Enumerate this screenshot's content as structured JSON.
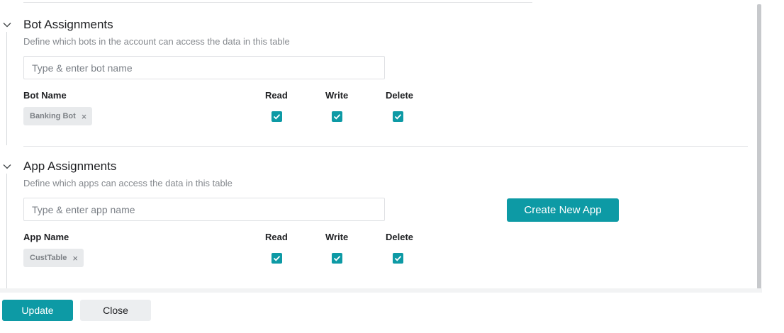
{
  "bot_assignments": {
    "title": "Bot Assignments",
    "description": "Define which bots in the account can access the data in this table",
    "input_placeholder": "Type & enter bot name",
    "columns": {
      "name": "Bot Name",
      "read": "Read",
      "write": "Write",
      "delete": "Delete"
    },
    "rows": [
      {
        "name": "Banking Bot",
        "remove": "×",
        "read": true,
        "write": true,
        "delete": true
      }
    ]
  },
  "app_assignments": {
    "title": "App Assignments",
    "description": "Define which apps can access the data in this table",
    "input_placeholder": "Type & enter app name",
    "create_button": "Create New App",
    "columns": {
      "name": "App Name",
      "read": "Read",
      "write": "Write",
      "delete": "Delete"
    },
    "rows": [
      {
        "name": "CustTable",
        "remove": "×",
        "read": true,
        "write": true,
        "delete": true
      }
    ]
  },
  "footer": {
    "update_label": "Update",
    "close_label": "Close"
  },
  "colors": {
    "accent": "#0d9aa5",
    "chip_bg": "#e8eaec",
    "muted_text": "#85898e"
  }
}
